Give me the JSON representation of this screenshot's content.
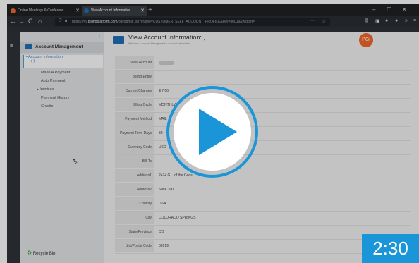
{
  "browser": {
    "tabs": [
      {
        "label": "Online Meetings & Conferenc",
        "active": false,
        "favicon_color": "#f26a2b"
      },
      {
        "label": "View Account Information",
        "active": true,
        "favicon_color": "#1e6fb8"
      }
    ],
    "new_tab": "+",
    "url_prefix": "https://my.",
    "url_domain": "billingplatform.com",
    "url_path": "/pgi/admin.jsp?iframe=CUSTOMER_SELF_ACCOUNT_PROFILE&key=80019&widget=",
    "window_controls": [
      "–",
      "☐",
      "✕"
    ],
    "nav": {
      "back": "←",
      "forward": "→",
      "reload": "C",
      "home": "⌂"
    }
  },
  "sidebar": {
    "section_title": "Account Management",
    "items": [
      {
        "label": "Account Information",
        "sub": "( )",
        "active": true
      },
      {
        "label": "Make A Payment"
      },
      {
        "label": "Auto Payment"
      },
      {
        "label": "Invoices",
        "expandable": true
      },
      {
        "label": "Payment History"
      },
      {
        "label": "Credits"
      }
    ],
    "footer": "Recycle Bin"
  },
  "header": {
    "title": "View Account Information: ,",
    "breadcrumb": "Welcome > Account Management > Account Information",
    "logo": "PGi"
  },
  "fields": [
    {
      "label": "View Account",
      "value": "",
      "blurred": true
    },
    {
      "label": "Billing Entity",
      "value": ""
    },
    {
      "label": "Current Charges",
      "value": "$ 7.66"
    },
    {
      "label": "Billing Cycle",
      "value": "MONTHLY"
    },
    {
      "label": "Payment Method",
      "value": "MAIL"
    },
    {
      "label": "Payment Term Days",
      "value": "30"
    },
    {
      "label": "Currency Code",
      "value": "USD"
    },
    {
      "label": "Bill To",
      "value": ""
    },
    {
      "label": "Address1",
      "value": "2424 G... of the Gods"
    },
    {
      "label": "Address2",
      "value": "Suite 300"
    },
    {
      "label": "Country",
      "value": "USA"
    },
    {
      "label": "City",
      "value": "COLORADO SPRINGS"
    },
    {
      "label": "State/Province",
      "value": "CO"
    },
    {
      "label": "Zip/Postal Code",
      "value": "80919"
    }
  ],
  "video": {
    "duration": "2:30",
    "accent_color": "#1a96d8"
  }
}
